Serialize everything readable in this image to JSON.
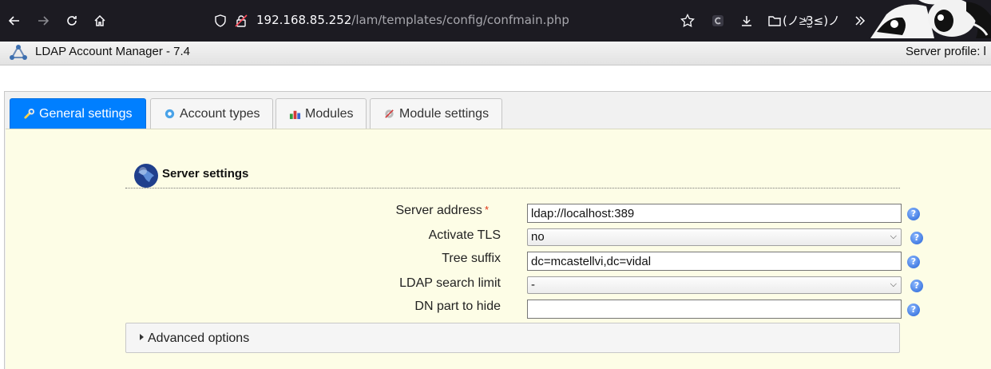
{
  "browser": {
    "url_host": "192.168.85.252",
    "url_path": "/lam/templates/config/confmain.php",
    "bookmark_label": "(ノ≥ͮ3̫≤)ノ"
  },
  "app": {
    "title": "LDAP Account Manager - 7.4",
    "server_profile": "Server profile: l"
  },
  "tabs": [
    {
      "label": "General settings",
      "icon": "wrench-icon",
      "active": true
    },
    {
      "label": "Account types",
      "icon": "account-types-icon",
      "active": false
    },
    {
      "label": "Modules",
      "icon": "modules-icon",
      "active": false
    },
    {
      "label": "Module settings",
      "icon": "module-settings-icon",
      "active": false
    }
  ],
  "section": {
    "title": "Server settings",
    "icon": "globe-icon"
  },
  "form": {
    "server_address": {
      "label": "Server address",
      "required_mark": "*",
      "value": "ldap://localhost:389"
    },
    "activate_tls": {
      "label": "Activate TLS",
      "value": "no"
    },
    "tree_suffix": {
      "label": "Tree suffix",
      "value": "dc=mcastellvi,dc=vidal"
    },
    "search_limit": {
      "label": "LDAP search limit",
      "value": "-"
    },
    "dn_hide": {
      "label": "DN part to hide",
      "value": ""
    }
  },
  "advanced": {
    "label": "Advanced options"
  },
  "colors": {
    "active_tab": "#007fff",
    "content_bg": "#fdfde6",
    "browser_bg": "#1c1b22"
  }
}
